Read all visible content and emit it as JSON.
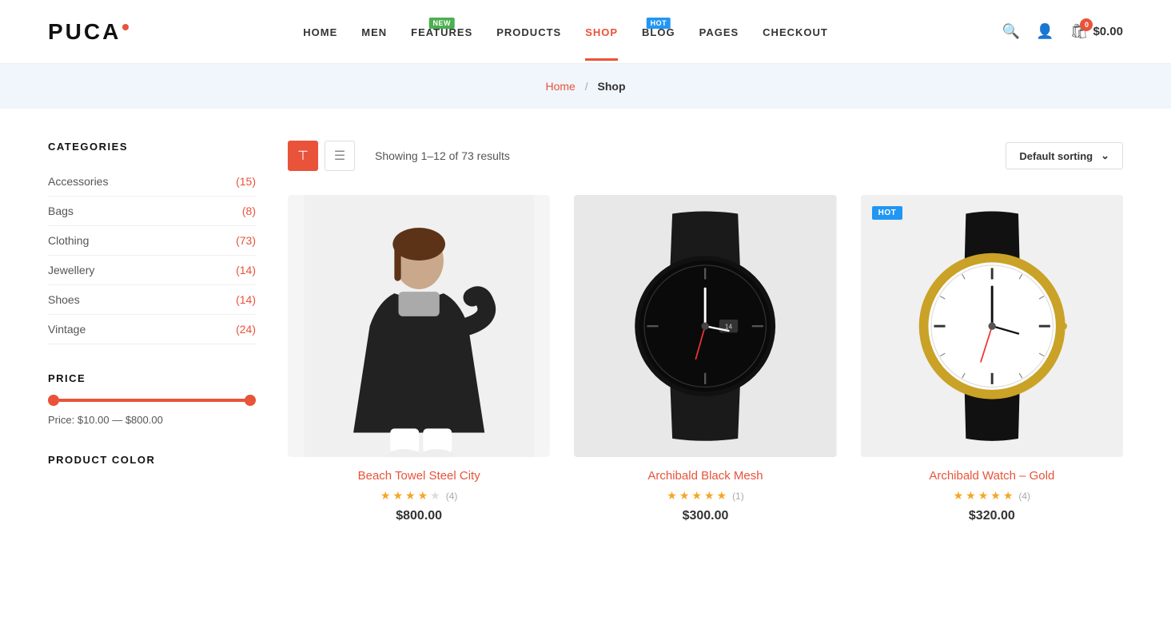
{
  "brand": {
    "name": "PUCA",
    "dot_color": "#e8533a"
  },
  "nav": {
    "items": [
      {
        "label": "HOME",
        "active": false,
        "badge": null
      },
      {
        "label": "MEN",
        "active": false,
        "badge": null
      },
      {
        "label": "FEATURES",
        "active": false,
        "badge": {
          "text": "NEW",
          "type": "new"
        }
      },
      {
        "label": "PRODUCTS",
        "active": false,
        "badge": null
      },
      {
        "label": "SHOP",
        "active": true,
        "badge": null
      },
      {
        "label": "BLOG",
        "active": false,
        "badge": {
          "text": "HOT",
          "type": "hot"
        }
      },
      {
        "label": "PAGES",
        "active": false,
        "badge": null
      },
      {
        "label": "CHECKOUT",
        "active": false,
        "badge": null
      }
    ],
    "cart": {
      "count": 0,
      "amount": "$0.00"
    }
  },
  "breadcrumb": {
    "home_label": "Home",
    "separator": "/",
    "current": "Shop"
  },
  "sidebar": {
    "categories_title": "CATEGORIES",
    "categories": [
      {
        "name": "Accessories",
        "count": "(15)"
      },
      {
        "name": "Bags",
        "count": "(8)"
      },
      {
        "name": "Clothing",
        "count": "(73)"
      },
      {
        "name": "Jewellery",
        "count": "(14)"
      },
      {
        "name": "Shoes",
        "count": "(14)"
      },
      {
        "name": "Vintage",
        "count": "(24)"
      }
    ],
    "price_title": "PRICE",
    "price_label": "Price: $10.00 — $800.00",
    "color_title": "PRODUCT COLOR"
  },
  "toolbar": {
    "results_text": "Showing 1–12 of 73 results",
    "sort_label": "Default sorting",
    "view_grid_title": "Grid view",
    "view_list_title": "List view"
  },
  "products": [
    {
      "id": 1,
      "name": "Beach Towel Steel City",
      "price": "$800.00",
      "stars": [
        1,
        1,
        1,
        1,
        0
      ],
      "review_count": "(4)",
      "badge": null,
      "type": "clothing"
    },
    {
      "id": 2,
      "name": "Archibald Black Mesh",
      "price": "$300.00",
      "stars": [
        1,
        1,
        1,
        1,
        1
      ],
      "review_count": "(1)",
      "badge": null,
      "type": "watch_black"
    },
    {
      "id": 3,
      "name": "Archibald Watch – Gold",
      "price": "$320.00",
      "stars": [
        1,
        1,
        1,
        1,
        1
      ],
      "review_count": "(4)",
      "badge": "HOT",
      "type": "watch_gold"
    }
  ]
}
